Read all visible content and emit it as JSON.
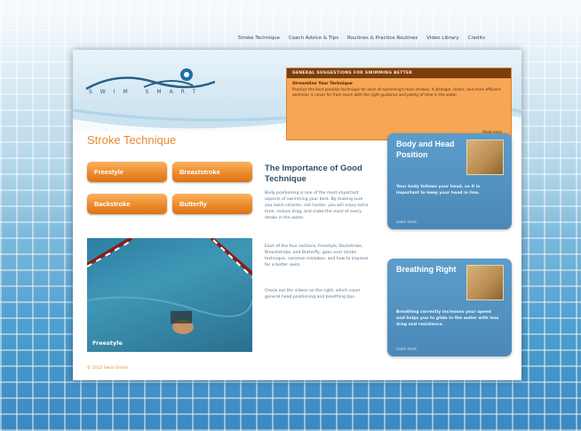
{
  "top_nav": [
    "Stroke Technique",
    "Coach Advice & Tips",
    "Routines & Practice Routines",
    "Video Library",
    "Credits"
  ],
  "logo": {
    "text": "SWIM SMART"
  },
  "note": {
    "header": "GENERAL SUGGESTIONS FOR SWIMMING BETTER",
    "title": "Streamline Your Technique",
    "body": "Practice the best possible technique for each of swimming's main strokes. A stronger, faster, and more efficient swimmer is never far from reach with the right guidance and plenty of time in the water.",
    "link": "Read more"
  },
  "section_title": "Stroke Technique",
  "buttons": {
    "freestyle": "Freestyle",
    "breaststroke": "Breaststroke",
    "backstroke": "Backstroke",
    "butterfly": "Butterfly"
  },
  "photo_caption": "Freestyle",
  "article": {
    "title": "The Importance of Good Technique",
    "p1": "Body positioning is one of the most important aspects of swimming your best. By making sure you swim smarter, not harder, you will enjoy extra time, reduce drag, and make the most of every stroke in the water.",
    "p2": "Each of the four sections, Freestyle, Backstroke, Breaststroke, and Butterfly, goes over stroke technique, common mistakes, and how to improve for a better swim.",
    "p3": "Check out the videos on the right, which cover general head positioning and breathing tips."
  },
  "cards": [
    {
      "title": "Body and Head Position",
      "body": "Your body follows your head, so it is important to keep your head in line.",
      "link": "Learn more"
    },
    {
      "title": "Breathing Right",
      "body": "Breathing correctly increases your speed and helps you to glide in the water with less drag and resistance.",
      "link": "Learn more"
    }
  ],
  "footer": "© 2012 Swim Smart",
  "colors": {
    "orange": "#ee8b2a",
    "blue": "#4b88b8",
    "dark_orange": "#7a3e10"
  }
}
